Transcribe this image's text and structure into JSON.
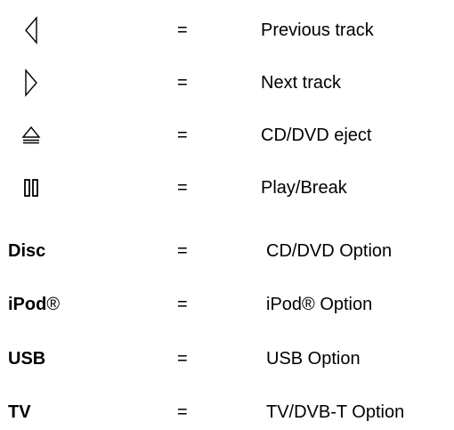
{
  "legend": {
    "separator": "=",
    "rows": [
      {
        "icon": "previous-track-icon",
        "description": "Previous track"
      },
      {
        "icon": "next-track-icon",
        "description": "Next track"
      },
      {
        "icon": "eject-icon",
        "description": "CD/DVD eject"
      },
      {
        "icon": "play-pause-icon",
        "description": "Play/Break"
      },
      {
        "key": "Disc",
        "description": "CD/DVD Option"
      },
      {
        "key": "iPod",
        "key_suffix": "®",
        "description": "iPod® Option"
      },
      {
        "key": "USB",
        "description": "USB Option"
      },
      {
        "key": "TV",
        "description": "TV/DVB-T Option"
      }
    ]
  }
}
